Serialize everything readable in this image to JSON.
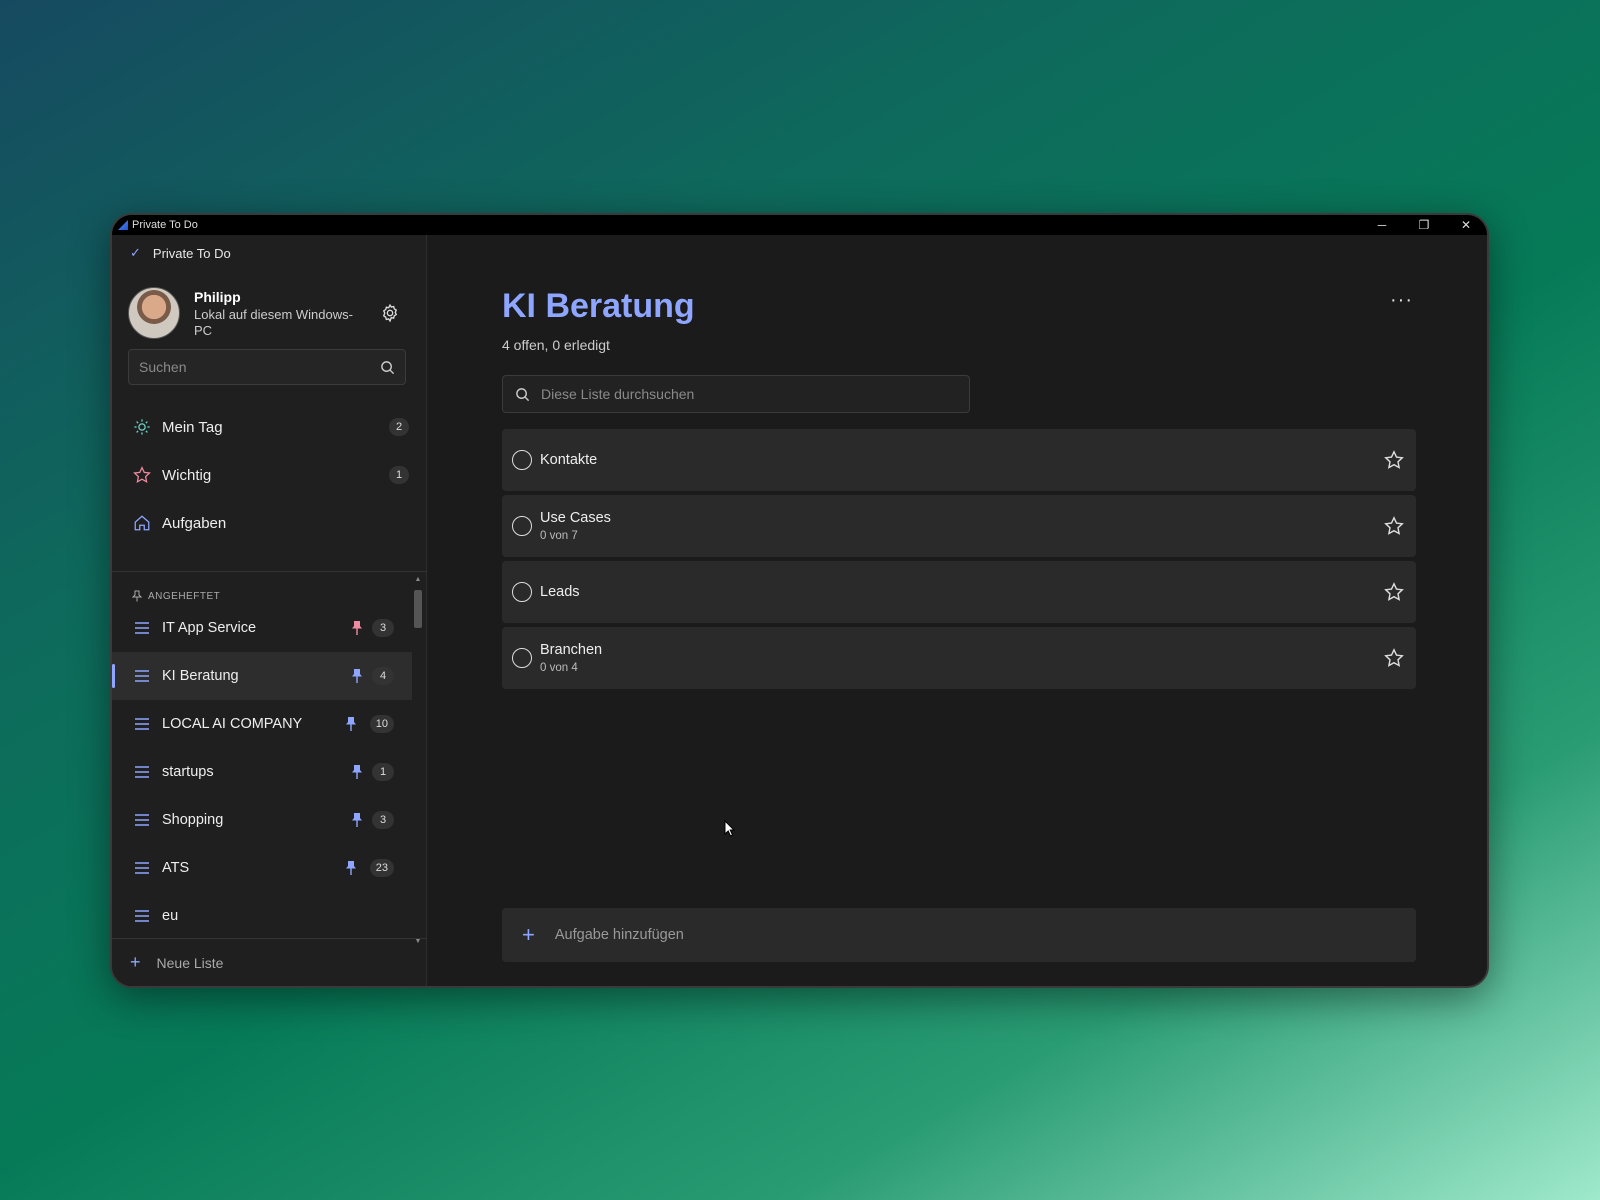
{
  "window": {
    "title": "Private To Do",
    "minimize": "─",
    "restore": "❐",
    "close": "✕"
  },
  "sidebar": {
    "app_name": "Private To Do",
    "profile": {
      "name": "Philipp",
      "subtitle": "Lokal auf diesem Windows-PC"
    },
    "search": {
      "placeholder": "Suchen"
    },
    "nav": [
      {
        "label": "Mein Tag",
        "icon": "sun-icon",
        "count": "2"
      },
      {
        "label": "Wichtig",
        "icon": "star-icon",
        "count": "1"
      },
      {
        "label": "Aufgaben",
        "icon": "home-icon",
        "count": ""
      }
    ],
    "pinned_label": "ANGEHEFTET",
    "lists": [
      {
        "label": "IT App Service",
        "pinned": true,
        "pin_color": "#f08aa0",
        "count": "3"
      },
      {
        "label": "KI Beratung",
        "pinned": true,
        "pin_color": "#8ea6ff",
        "count": "4",
        "active": true
      },
      {
        "label": "LOCAL AI COMPANY",
        "pinned": true,
        "pin_color": "#8ea6ff",
        "count": "10"
      },
      {
        "label": "startups",
        "pinned": true,
        "pin_color": "#8ea6ff",
        "count": "1"
      },
      {
        "label": "Shopping",
        "pinned": true,
        "pin_color": "#8ea6ff",
        "count": "3"
      },
      {
        "label": "ATS",
        "pinned": true,
        "pin_color": "#8ea6ff",
        "count": "23"
      },
      {
        "label": "eu",
        "pinned": false,
        "count": ""
      }
    ],
    "new_list": "Neue Liste"
  },
  "main": {
    "title": "KI Beratung",
    "stats": "4 offen, 0 erledigt",
    "more": "···",
    "search": {
      "placeholder": "Diese Liste durchsuchen"
    },
    "tasks": [
      {
        "name": "Kontakte",
        "sub": ""
      },
      {
        "name": "Use Cases",
        "sub": "0 von 7"
      },
      {
        "name": "Leads",
        "sub": ""
      },
      {
        "name": "Branchen",
        "sub": "0 von 4"
      }
    ],
    "add_task": "Aufgabe hinzufügen"
  },
  "colors": {
    "accent": "#8ea6ff",
    "pin_pink": "#f08aa0"
  }
}
